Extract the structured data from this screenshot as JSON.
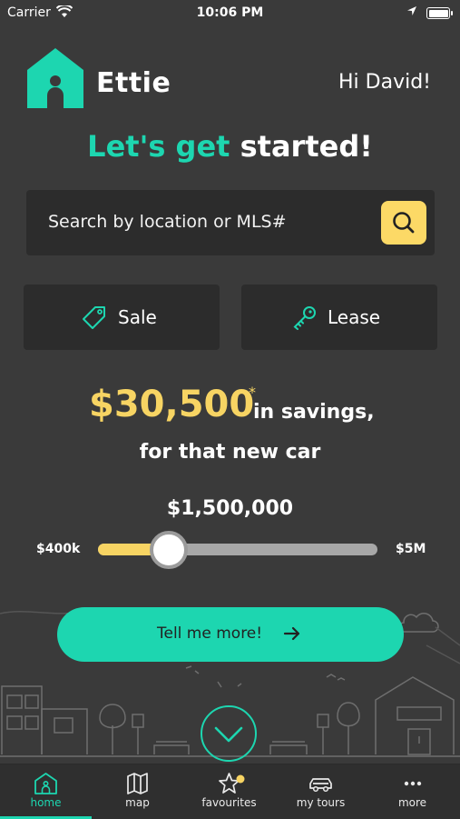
{
  "status": {
    "carrier": "Carrier",
    "time": "10:06 PM"
  },
  "brand": {
    "name": "Ettie"
  },
  "greeting": "Hi David!",
  "headline": {
    "accent": "Let's get",
    "rest": " started!"
  },
  "search": {
    "placeholder": "Search by location or MLS#"
  },
  "listing_types": {
    "sale": "Sale",
    "lease": "Lease"
  },
  "savings": {
    "amount": "$30,500",
    "footnote": "*",
    "suffix": "in savings,",
    "tagline": "for that new car"
  },
  "price_slider": {
    "value": "$1,500,000",
    "min_label": "$400k",
    "max_label": "$5M",
    "fill_fraction": 0.24
  },
  "cta": {
    "label": "Tell me more!"
  },
  "tabs": [
    {
      "label": "home",
      "icon": "home-icon",
      "active": true
    },
    {
      "label": "map",
      "icon": "map-icon",
      "active": false
    },
    {
      "label": "favourites",
      "icon": "star-icon",
      "active": false
    },
    {
      "label": "my tours",
      "icon": "car-icon",
      "active": false
    },
    {
      "label": "more",
      "icon": "more-icon",
      "active": false
    }
  ],
  "colors": {
    "background": "#3a3a3a",
    "accent": "#1dd6b0",
    "highlight": "#f7d463",
    "panel": "#2c2c2c"
  }
}
